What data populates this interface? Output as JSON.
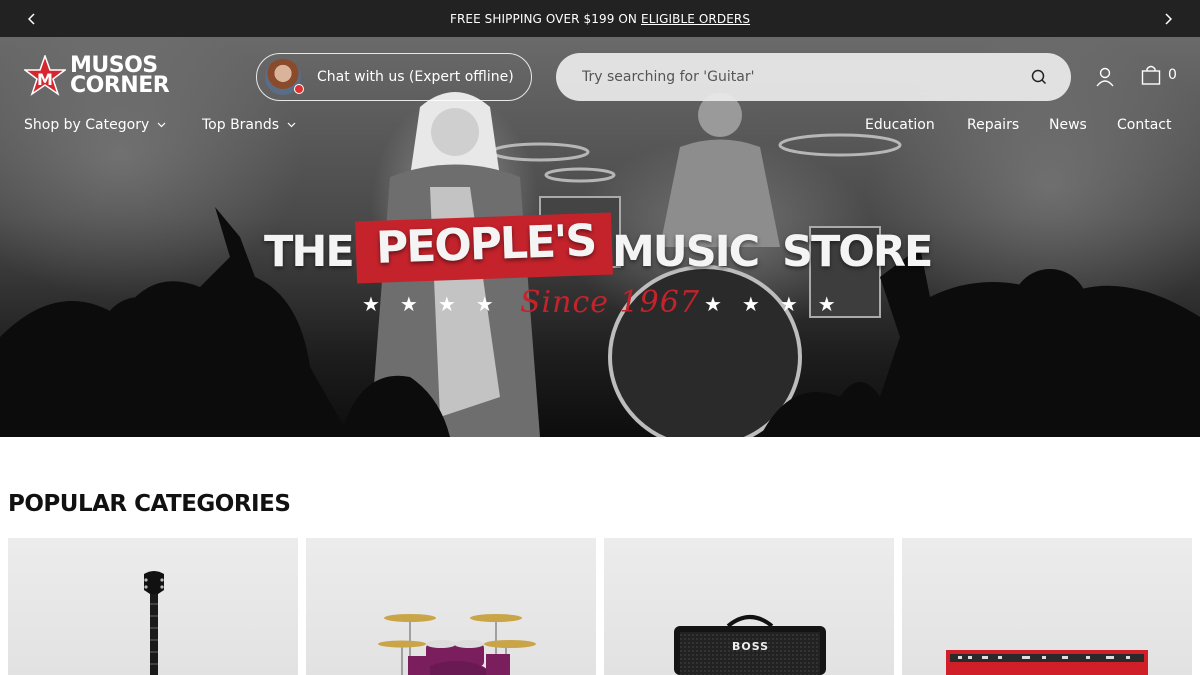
{
  "announcement": {
    "text": "FREE SHIPPING OVER $199 ON",
    "link_text": "ELIGIBLE ORDERS"
  },
  "header": {
    "logo_line1": "MUSOS",
    "logo_line2": "CORNER",
    "chat_label": "Chat with us (Expert offline)",
    "search_placeholder": "Try searching for 'Guitar'",
    "cart_count": "0"
  },
  "nav": {
    "left": [
      {
        "label": "Shop by Category"
      },
      {
        "label": "Top Brands"
      }
    ],
    "right": [
      {
        "label": "Education"
      },
      {
        "label": "Repairs"
      },
      {
        "label": "News"
      },
      {
        "label": "Contact"
      }
    ]
  },
  "hero": {
    "word_the": "THE",
    "word_peoples": "PEOPLE'S",
    "word_music": "MUSIC",
    "word_store": "STORE",
    "since": "Since 1967",
    "stars_left": "★★★★",
    "stars_right": "★★★★"
  },
  "popular": {
    "title": "POPULAR CATEGORIES",
    "cards": [
      {
        "icon": "electric-guitar"
      },
      {
        "icon": "drum-kit"
      },
      {
        "icon": "guitar-amplifier",
        "brand_text": "BOSS"
      },
      {
        "icon": "keyboard-synth"
      }
    ]
  },
  "colors": {
    "bar": "#222222",
    "accent_red": "#c4232c"
  }
}
